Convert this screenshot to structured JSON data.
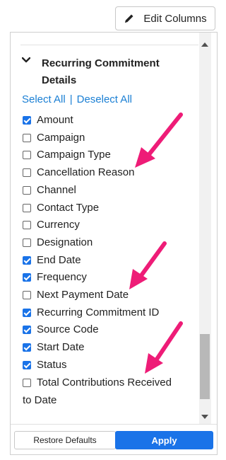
{
  "toolbar": {
    "edit_columns_label": "Edit Columns",
    "edit_icon": "pencil-icon"
  },
  "panel": {
    "clipped_previous_label": "",
    "section_title": "Recurring Commitment Details",
    "select_all": "Select All",
    "separator": "|",
    "deselect_all": "Deselect All",
    "items": [
      {
        "label": "Amount",
        "checked": true
      },
      {
        "label": "Campaign",
        "checked": false
      },
      {
        "label": "Campaign Type",
        "checked": false
      },
      {
        "label": "Cancellation Reason",
        "checked": false
      },
      {
        "label": "Channel",
        "checked": false
      },
      {
        "label": "Contact Type",
        "checked": false
      },
      {
        "label": "Currency",
        "checked": false
      },
      {
        "label": "Designation",
        "checked": false
      },
      {
        "label": "End Date",
        "checked": true
      },
      {
        "label": "Frequency",
        "checked": true
      },
      {
        "label": "Next Payment Date",
        "checked": false
      },
      {
        "label": "Recurring Commitment ID",
        "checked": true
      },
      {
        "label": "Source Code",
        "checked": true
      },
      {
        "label": "Start Date",
        "checked": true
      },
      {
        "label": "Status",
        "checked": true
      },
      {
        "label": "Total Contributions Received to Date",
        "checked": false
      }
    ],
    "restore_defaults": "Restore Defaults",
    "apply": "Apply"
  },
  "colors": {
    "accent": "#1a73e8",
    "link": "#1a7fd4",
    "annotation_arrow": "#ee1c77"
  }
}
